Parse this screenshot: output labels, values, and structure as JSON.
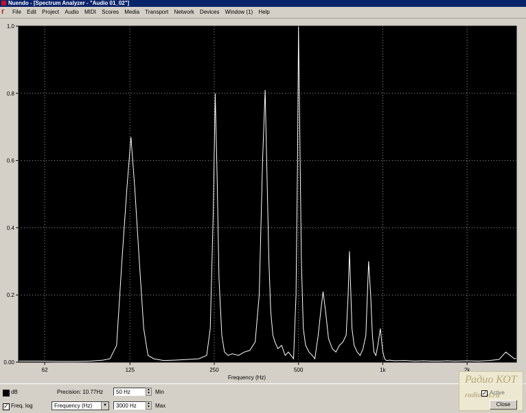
{
  "window": {
    "title": "Nuendo - [Spectrum Analyzer - \"Audio 01_02\"]"
  },
  "menu": {
    "items": [
      "File",
      "Edit",
      "Project",
      "Audio",
      "MIDI",
      "Scores",
      "Media",
      "Transport",
      "Network",
      "Devices",
      "Window (1)",
      "Help"
    ]
  },
  "chart_data": {
    "type": "line",
    "title": "",
    "xlabel": "Frequency (Hz)",
    "ylabel": "",
    "x_scale": "log",
    "xlim": [
      50,
      3000
    ],
    "ylim": [
      0,
      1.0
    ],
    "grid": true,
    "background": "#000000",
    "line_color": "#ffffff",
    "grid_color": "#a0a0a0",
    "y_ticks": [
      0.0,
      0.2,
      0.4,
      0.6,
      0.8,
      1.0
    ],
    "y_tick_labels": [
      "0.00",
      "0.2",
      "0.4",
      "0.6",
      "0.8",
      "1.0"
    ],
    "x_ticks": [
      62,
      125,
      250,
      500,
      1000,
      2000
    ],
    "x_tick_labels": [
      "62",
      "125",
      "250",
      "500",
      "1k",
      "2k"
    ],
    "x": [
      50,
      60,
      70,
      80,
      90,
      100,
      106,
      112,
      117,
      122,
      126,
      130,
      135,
      140,
      145,
      152,
      165,
      180,
      200,
      220,
      235,
      242,
      248,
      252,
      256,
      260,
      266,
      272,
      280,
      290,
      305,
      320,
      335,
      350,
      362,
      372,
      380,
      386,
      392,
      398,
      405,
      412,
      422,
      435,
      448,
      460,
      470,
      480,
      490,
      496,
      500,
      505,
      512,
      520,
      530,
      545,
      560,
      572,
      588,
      600,
      612,
      625,
      640,
      660,
      680,
      700,
      720,
      740,
      752,
      760,
      768,
      776,
      790,
      810,
      830,
      850,
      870,
      890,
      905,
      918,
      930,
      945,
      960,
      980,
      1000,
      1015,
      1030,
      1060,
      1100,
      1200,
      1300,
      1400,
      1500,
      1600,
      1700,
      1800,
      2000,
      2200,
      2400,
      2600,
      2750,
      2850,
      2950,
      3000
    ],
    "y": [
      0.003,
      0.003,
      0.002,
      0.002,
      0.003,
      0.006,
      0.01,
      0.05,
      0.3,
      0.52,
      0.67,
      0.52,
      0.3,
      0.1,
      0.02,
      0.01,
      0.005,
      0.006,
      0.008,
      0.01,
      0.02,
      0.1,
      0.45,
      0.8,
      0.55,
      0.25,
      0.08,
      0.03,
      0.02,
      0.025,
      0.02,
      0.03,
      0.035,
      0.06,
      0.2,
      0.6,
      0.81,
      0.55,
      0.3,
      0.15,
      0.08,
      0.06,
      0.04,
      0.05,
      0.02,
      0.03,
      0.02,
      0.01,
      0.2,
      0.6,
      1.0,
      0.7,
      0.3,
      0.1,
      0.05,
      0.03,
      0.02,
      0.01,
      0.08,
      0.15,
      0.21,
      0.15,
      0.07,
      0.04,
      0.03,
      0.05,
      0.06,
      0.08,
      0.2,
      0.33,
      0.22,
      0.1,
      0.05,
      0.03,
      0.02,
      0.04,
      0.08,
      0.3,
      0.2,
      0.08,
      0.03,
      0.02,
      0.05,
      0.1,
      0.03,
      0.01,
      0.005,
      0.006,
      0.004,
      0.005,
      0.003,
      0.004,
      0.003,
      0.003,
      0.004,
      0.003,
      0.004,
      0.003,
      0.005,
      0.008,
      0.03,
      0.02,
      0.01,
      0.012
    ]
  },
  "controls": {
    "db_label": "dB",
    "freqlog_label": "Freq. log",
    "precision_label": "Precision: 10.77Hz",
    "min_value": "50 Hz",
    "min_label": "Min",
    "max_value": "3000 Hz",
    "max_label": "Max",
    "unit_select": "Frequency (Hz)",
    "active_label": "Active",
    "close_label": "Close"
  },
  "watermark": {
    "top": "Радио КОТ",
    "bottom": "radiokot.ru"
  }
}
